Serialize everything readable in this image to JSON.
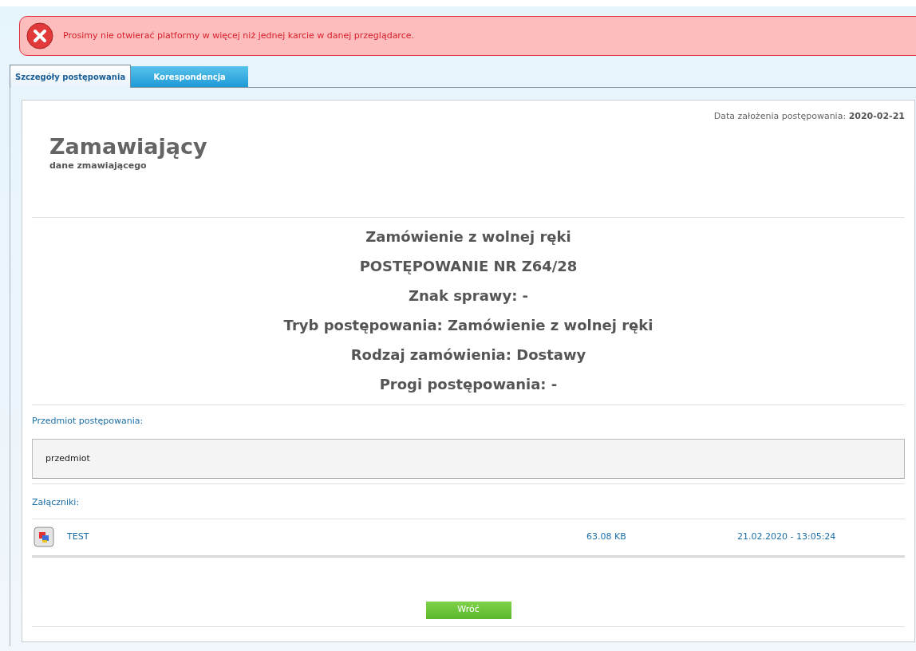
{
  "alert": {
    "message": "Prosimy nie otwierać platformy w więcej niż jednej karcie w danej przeglądarce."
  },
  "tabs": [
    {
      "label": "Szczegóły postępowania",
      "selected": true
    },
    {
      "label": "Korespondencja",
      "selected": false
    }
  ],
  "founded_date": {
    "label": "Data założenia postępowania:",
    "value": "2020-02-21"
  },
  "buyer": {
    "title": "Zamawiający",
    "subtitle": "dane zmawiającego"
  },
  "headings": [
    "Zamówienie z wolnej ręki",
    "POSTĘPOWANIE NR Z64/28",
    "Znak sprawy: -",
    "Tryb postępowania: Zamówienie z wolnej ręki",
    "Rodzaj zamówienia: Dostawy",
    "Progi postępowania: -"
  ],
  "subject": {
    "label": "Przedmiot postępowania:",
    "value": "przedmiot"
  },
  "attachments": {
    "label": "Załączniki:",
    "files": [
      {
        "name": "TEST",
        "size": "63.08 KB",
        "date": "21.02.2020 - 13:05:24"
      }
    ]
  },
  "back_button": "Wróć"
}
